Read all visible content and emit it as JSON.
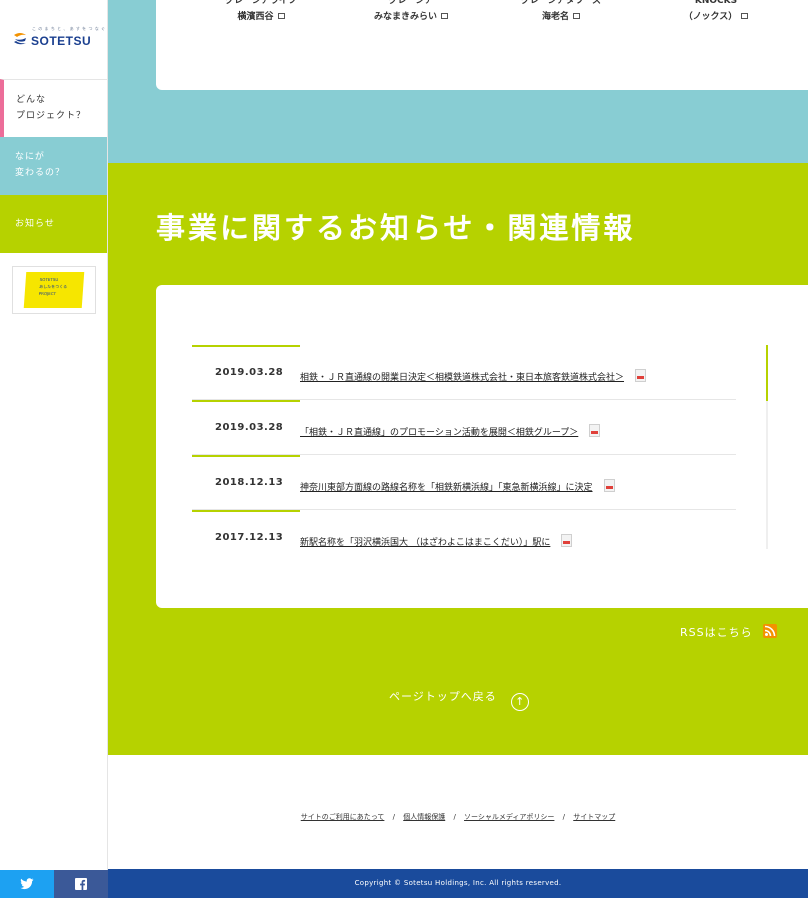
{
  "sidebar": {
    "logo": {
      "tagline": "こ の ま ち と 、 あ す を つ な ぐ",
      "brand": "SOTETSU"
    },
    "nav": [
      {
        "label": "どんな\nプロジェクト？"
      },
      {
        "label": "なにが\n変わるの？"
      },
      {
        "label": "お知らせ"
      }
    ],
    "banner": {
      "lines": [
        "SOTETSU",
        "あしたをつくる",
        "PROJECT"
      ]
    }
  },
  "partners": [
    {
      "top": "グレーシアライフ",
      "name": "横濱西谷"
    },
    {
      "top": "グレーシア",
      "name": "みなまきみらい"
    },
    {
      "top": "グレーシアタワーズ",
      "name": "海老名"
    },
    {
      "top": "KNOCKS",
      "name": "（ノックス）"
    }
  ],
  "news_section": {
    "title": "事業に関するお知らせ・関連情報",
    "items": [
      {
        "date": "2019.03.28",
        "text": "相鉄・ＪＲ直通線の開業日決定＜相模鉄道株式会社・東日本旅客鉄道株式会社＞"
      },
      {
        "date": "2019.03.28",
        "text": "「相鉄・ＪＲ直通線」のプロモーション活動を展開＜相鉄グループ＞"
      },
      {
        "date": "2018.12.13",
        "text": "神奈川東部方面線の路線名称を「相鉄新横浜線」「東急新横浜線」に決定"
      },
      {
        "date": "2017.12.13",
        "text": "新駅名称を「羽沢横浜国大 （はざわよこはまこくだい）」駅に"
      }
    ],
    "rss_label": "RSSはこちら",
    "pagetop_label": "ページトップへ戻る"
  },
  "footer": {
    "links": [
      "サイトのご利用にあたって",
      "個人情報保護",
      "ソーシャルメディアポリシー",
      "サイトマップ"
    ],
    "separator": "/",
    "copyright": "Copyright © Sotetsu Holdings, Inc. All rights reserved."
  },
  "colors": {
    "teal": "#88cdd3",
    "green": "#b6d200",
    "pink": "#ec6d99",
    "navy": "#1a4b9c",
    "twitter": "#1da1f2",
    "facebook": "#3b5998"
  }
}
